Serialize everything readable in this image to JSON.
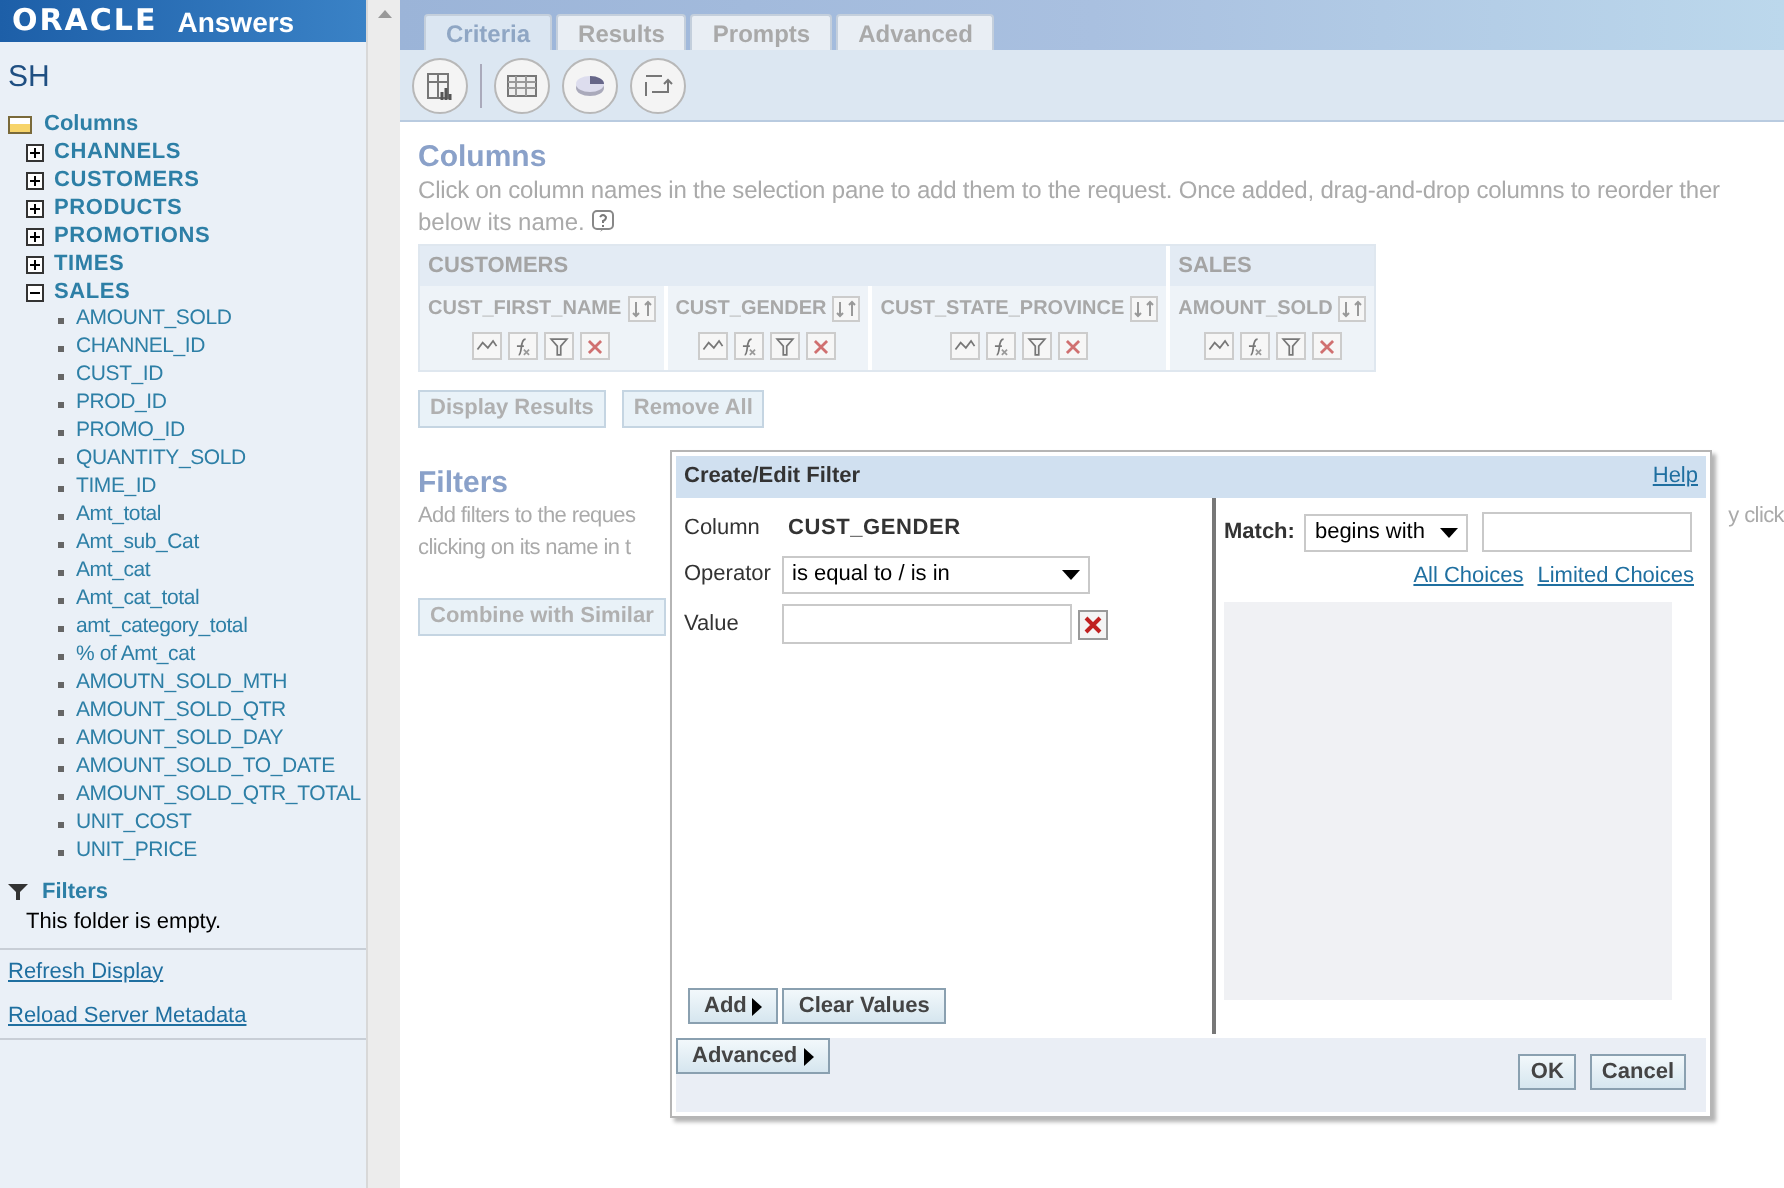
{
  "header": {
    "brand": "ORACLE",
    "product": "Answers"
  },
  "sidebar": {
    "subject_area": "SH",
    "columns": {
      "label": "Columns",
      "folders": [
        {
          "label": "CHANNELS",
          "expanded": false
        },
        {
          "label": "CUSTOMERS",
          "expanded": false
        },
        {
          "label": "PRODUCTS",
          "expanded": false
        },
        {
          "label": "PROMOTIONS",
          "expanded": false
        },
        {
          "label": "TIMES",
          "expanded": false
        },
        {
          "label": "SALES",
          "expanded": true,
          "children": [
            "AMOUNT_SOLD",
            "CHANNEL_ID",
            "CUST_ID",
            "PROD_ID",
            "PROMO_ID",
            "QUANTITY_SOLD",
            "TIME_ID",
            "Amt_total",
            "Amt_sub_Cat",
            "Amt_cat",
            "Amt_cat_total",
            "amt_category_total",
            "% of Amt_cat",
            "AMOUTN_SOLD_MTH",
            "AMOUNT_SOLD_QTR",
            "AMOUNT_SOLD_DAY",
            "AMOUNT_SOLD_TO_DATE",
            "AMOUNT_SOLD_QTR_TOTAL",
            "UNIT_COST",
            "UNIT_PRICE"
          ]
        }
      ]
    },
    "filters": {
      "label": "Filters",
      "empty_text": "This folder is empty."
    },
    "links": [
      "Refresh Display",
      "Reload Server Metadata"
    ]
  },
  "tabs": [
    {
      "label": "Criteria",
      "selected": true
    },
    {
      "label": "Results",
      "selected": false
    },
    {
      "label": "Prompts",
      "selected": false
    },
    {
      "label": "Advanced",
      "selected": false
    }
  ],
  "columns_section": {
    "title": "Columns",
    "description_line_1": "Click on column names in the selection pane to add them to the request. Once added, drag-and-drop columns to reorder ther",
    "description_line_2": "below its name.",
    "groups": [
      {
        "name": "CUSTOMERS",
        "columns": [
          "CUST_FIRST_NAME",
          "CUST_GENDER",
          "CUST_STATE_PROVINCE"
        ]
      },
      {
        "name": "SALES",
        "columns": [
          "AMOUNT_SOLD"
        ]
      }
    ],
    "buttons": [
      "Display Results",
      "Remove All"
    ]
  },
  "filters_section": {
    "title": "Filters",
    "description_left": [
      "Add filters to the reques",
      "clicking on its name in t"
    ],
    "description_right": "y click",
    "button": "Combine with Similar"
  },
  "dialog": {
    "title": "Create/Edit Filter",
    "help": "Help",
    "column_label": "Column",
    "column_value": "CUST_GENDER",
    "operator_label": "Operator",
    "operator_value": "is equal to / is in",
    "value_label": "Value",
    "match_label": "Match:",
    "match_value": "begins with",
    "choice_links": [
      "All Choices",
      "Limited Choices"
    ],
    "left_buttons": [
      "Add",
      "Clear Values"
    ],
    "advanced_button": "Advanced",
    "footer_buttons": [
      "OK",
      "Cancel"
    ]
  }
}
